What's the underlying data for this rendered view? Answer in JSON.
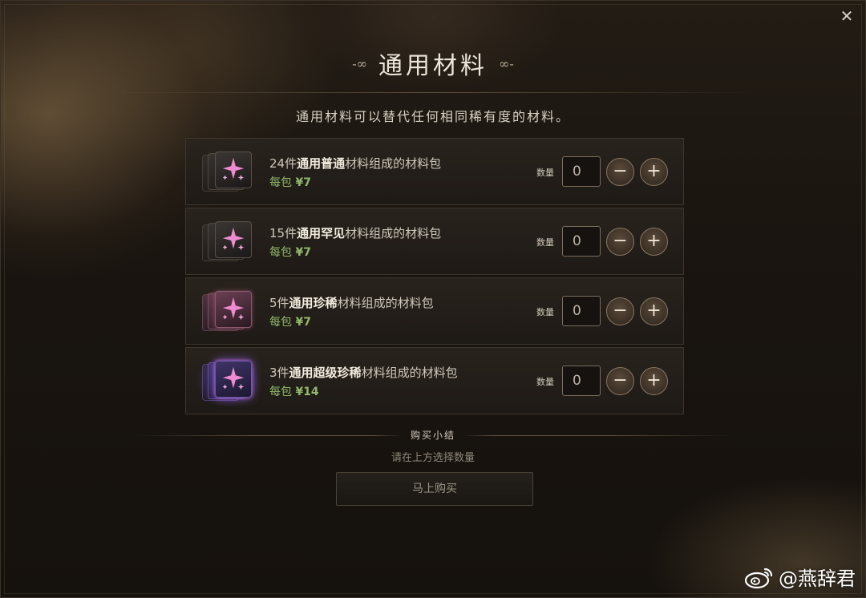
{
  "dialog": {
    "title": "通用材料",
    "title_ornament_left": "-∞",
    "title_ornament_right": "∞-",
    "subtitle": "通用材料可以替代任何相同稀有度的材料。",
    "close_glyph": "✕"
  },
  "items": [
    {
      "prefix": "24件",
      "bold": "通用普通",
      "suffix": "材料组成的材料包",
      "price_label": "每包",
      "price": "¥7",
      "qty_label": "数量",
      "qty_value": "0",
      "rarity": "common",
      "icon": "sparkle-star-card-icon"
    },
    {
      "prefix": "15件",
      "bold": "通用罕见",
      "suffix": "材料组成的材料包",
      "price_label": "每包",
      "price": "¥7",
      "qty_label": "数量",
      "qty_value": "0",
      "rarity": "uncommon",
      "icon": "sparkle-star-card-icon"
    },
    {
      "prefix": "5件",
      "bold": "通用珍稀",
      "suffix": "材料组成的材料包",
      "price_label": "每包",
      "price": "¥7",
      "qty_label": "数量",
      "qty_value": "0",
      "rarity": "rare",
      "icon": "sparkle-star-card-icon"
    },
    {
      "prefix": "3件",
      "bold": "通用超级珍稀",
      "suffix": "材料组成的材料包",
      "price_label": "每包",
      "price": "¥14",
      "qty_label": "数量",
      "qty_value": "0",
      "rarity": "epic",
      "icon": "sparkle-star-card-icon"
    }
  ],
  "stepper": {
    "minus": "−",
    "plus": "+"
  },
  "summary": {
    "title": "购买小结",
    "hint": "请在上方选择数量",
    "buy_label": "马上购买"
  },
  "watermark": {
    "text": "@燕辞君",
    "icon": "weibo-icon"
  },
  "colors": {
    "price_green": "#8fb86a",
    "star_pink": "#f08ad0",
    "epic_glow": "#8c5aff"
  }
}
